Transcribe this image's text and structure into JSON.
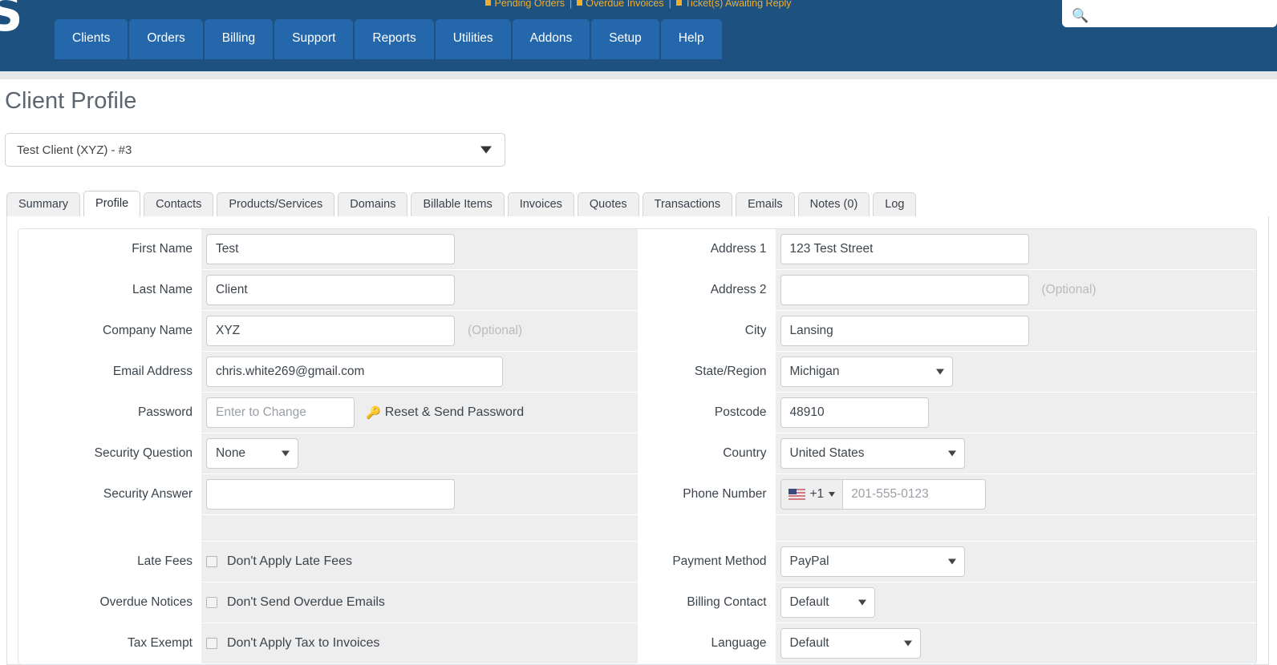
{
  "colors": {
    "nav_bg": "#1d5180",
    "nav_tab_bg": "#2468ab",
    "alert_text": "#f0ad2e",
    "row_bg": "#eeeeee",
    "page_title": "#5c6670"
  },
  "topbar": {
    "logo_glyph": "S",
    "alerts": [
      "Pending Orders",
      "Overdue Invoices",
      "Ticket(s) Awaiting Reply"
    ],
    "alert_separator": "|",
    "search": {
      "placeholder": "",
      "value": "",
      "icon": "search-icon"
    },
    "nav_items": [
      "Clients",
      "Orders",
      "Billing",
      "Support",
      "Reports",
      "Utilities",
      "Addons",
      "Setup",
      "Help"
    ]
  },
  "page": {
    "title": "Client Profile",
    "client_selector": {
      "value": "Test Client (XYZ) - #3"
    },
    "tabs": [
      {
        "label": "Summary",
        "active": false
      },
      {
        "label": "Profile",
        "active": true
      },
      {
        "label": "Contacts",
        "active": false
      },
      {
        "label": "Products/Services",
        "active": false
      },
      {
        "label": "Domains",
        "active": false
      },
      {
        "label": "Billable Items",
        "active": false
      },
      {
        "label": "Invoices",
        "active": false
      },
      {
        "label": "Quotes",
        "active": false
      },
      {
        "label": "Transactions",
        "active": false
      },
      {
        "label": "Emails",
        "active": false
      },
      {
        "label": "Notes (0)",
        "active": false
      },
      {
        "label": "Log",
        "active": false
      }
    ]
  },
  "form": {
    "left": {
      "first_name": {
        "label": "First Name",
        "value": "Test"
      },
      "last_name": {
        "label": "Last Name",
        "value": "Client"
      },
      "company": {
        "label": "Company Name",
        "value": "XYZ",
        "hint": "(Optional)"
      },
      "email": {
        "label": "Email Address",
        "value": "chris.white269@gmail.com"
      },
      "password": {
        "label": "Password",
        "placeholder": "Enter to Change",
        "reset_link": "Reset & Send Password",
        "reset_icon": "key-icon"
      },
      "sec_question": {
        "label": "Security Question",
        "value": "None"
      },
      "sec_answer": {
        "label": "Security Answer",
        "value": ""
      },
      "late_fees": {
        "label": "Late Fees",
        "checkbox_label": "Don't Apply Late Fees",
        "checked": false
      },
      "overdue": {
        "label": "Overdue Notices",
        "checkbox_label": "Don't Send Overdue Emails",
        "checked": false
      },
      "tax_exempt": {
        "label": "Tax Exempt",
        "checkbox_label": "Don't Apply Tax to Invoices",
        "checked": false
      }
    },
    "right": {
      "address1": {
        "label": "Address 1",
        "value": "123 Test Street"
      },
      "address2": {
        "label": "Address 2",
        "value": "",
        "hint": "(Optional)"
      },
      "city": {
        "label": "City",
        "value": "Lansing"
      },
      "state": {
        "label": "State/Region",
        "value": "Michigan"
      },
      "postcode": {
        "label": "Postcode",
        "value": "48910"
      },
      "country": {
        "label": "Country",
        "value": "United States"
      },
      "phone": {
        "label": "Phone Number",
        "dial_code": "+1",
        "placeholder": "201-555-0123",
        "value": "",
        "flag": "us-flag-icon"
      },
      "payment": {
        "label": "Payment Method",
        "value": "PayPal"
      },
      "billing": {
        "label": "Billing Contact",
        "value": "Default"
      },
      "language": {
        "label": "Language",
        "value": "Default"
      }
    }
  }
}
